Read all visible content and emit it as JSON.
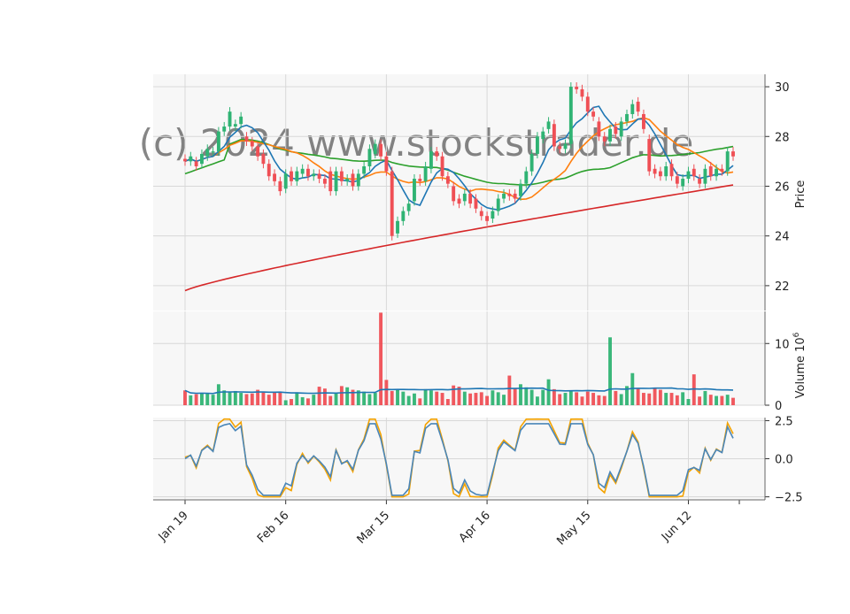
{
  "chart_data": {
    "type": "candlestick",
    "watermark": "(c) 2024 www.stockstrader.de",
    "x_tick_labels": [
      "Jan 19",
      "Feb 16",
      "Mar 15",
      "Apr 16",
      "May 15",
      "Jun 12"
    ],
    "colors": {
      "up": "#2fb373",
      "down": "#ef4f55",
      "ma_fast": "#1f77b4",
      "ma_mid": "#ff7f0e",
      "ma_slow": "#2ca02c",
      "ma_long": "#d62728",
      "vol_avg": "#1f77b4",
      "osc_a": "#4a86b8",
      "osc_b": "#f5a300",
      "grid": "#d8d8d8",
      "panel_bg": "#f7f7f7"
    },
    "panels": {
      "price": {
        "ylabel": "Price",
        "ylim": [
          21,
          30.5
        ],
        "ticks": [
          22,
          24,
          26,
          28,
          30
        ]
      },
      "volume": {
        "ylabel": "Volume",
        "ylabel_exp": "6",
        "ylim": [
          0,
          15.2
        ],
        "ticks": [
          0,
          10
        ]
      },
      "oscillator": {
        "ylim": [
          -2.7,
          2.7
        ],
        "ticks": [
          2.5,
          0.0,
          -2.5
        ],
        "tick_labels": [
          "2.5",
          "0.0",
          "−2.5"
        ]
      }
    },
    "ohlc_close": [
      27.0,
      27.2,
      26.8,
      27.3,
      27.5,
      27.4,
      28.2,
      28.4,
      29.0,
      28.5,
      28.8,
      27.8,
      27.6,
      27.2,
      26.9,
      26.4,
      26.2,
      25.8,
      26.5,
      26.2,
      26.6,
      26.7,
      26.4,
      26.5,
      26.3,
      26.1,
      25.8,
      26.6,
      26.2,
      26.3,
      26.0,
      26.5,
      26.8,
      27.5,
      27.7,
      27.2,
      26.6,
      24.0,
      24.6,
      25.0,
      25.3,
      26.3,
      26.2,
      26.8,
      27.4,
      27.2,
      26.4,
      26.1,
      25.4,
      25.3,
      25.7,
      25.3,
      25.1,
      24.8,
      24.6,
      25.0,
      25.5,
      25.7,
      25.6,
      25.5,
      26.1,
      26.6,
      27.3,
      28.0,
      28.2,
      28.6,
      27.6,
      27.5,
      27.7,
      30.0,
      29.9,
      29.6,
      29.0,
      28.8,
      28.0,
      27.8,
      28.3,
      28.1,
      28.6,
      28.9,
      29.3,
      29.0,
      28.3,
      26.6,
      26.5,
      26.4,
      26.8,
      26.4,
      26.1,
      26.3,
      26.6,
      26.4,
      26.1,
      26.7,
      26.4,
      26.7,
      26.6,
      27.4,
      27.2
    ],
    "ohlc_open": [
      27.1,
      27.0,
      27.0,
      26.9,
      27.2,
      27.4,
      27.4,
      28.2,
      28.4,
      28.4,
      28.5,
      28.0,
      27.8,
      27.6,
      27.3,
      26.9,
      26.5,
      26.2,
      25.9,
      26.6,
      26.2,
      26.5,
      26.7,
      26.4,
      26.5,
      26.3,
      26.6,
      25.8,
      26.6,
      26.2,
      26.5,
      26.0,
      26.5,
      26.8,
      27.3,
      27.7,
      27.2,
      26.6,
      24.1,
      24.6,
      25.0,
      25.4,
      26.3,
      26.2,
      26.7,
      27.4,
      27.2,
      26.4,
      26.0,
      25.5,
      25.4,
      25.7,
      25.5,
      25.0,
      24.8,
      24.7,
      25.0,
      25.5,
      25.7,
      25.7,
      25.6,
      26.1,
      26.6,
      27.3,
      27.9,
      28.3,
      28.5,
      27.6,
      27.5,
      27.7,
      30.0,
      29.9,
      29.6,
      29.0,
      28.6,
      28.0,
      27.8,
      28.4,
      28.0,
      28.6,
      28.9,
      29.4,
      28.9,
      27.9,
      26.7,
      26.6,
      26.4,
      26.9,
      26.4,
      26.0,
      26.3,
      26.7,
      26.3,
      26.1,
      26.8,
      26.4,
      26.7,
      26.6,
      27.4
    ],
    "volume_vals": [
      2.4,
      1.6,
      1.8,
      2.0,
      1.9,
      1.7,
      3.4,
      2.4,
      2.2,
      2.3,
      2.0,
      1.8,
      1.9,
      2.5,
      2.2,
      1.7,
      2.1,
      2.2,
      0.8,
      1.0,
      2.1,
      1.3,
      1.1,
      1.7,
      3.0,
      2.7,
      1.5,
      1.9,
      3.1,
      2.9,
      2.5,
      2.4,
      2.2,
      1.8,
      2.0,
      15.0,
      4.1,
      2.3,
      2.5,
      2.2,
      1.5,
      1.9,
      1.1,
      2.6,
      2.4,
      2.2,
      2.0,
      1.0,
      3.2,
      3.0,
      2.2,
      1.9,
      2.0,
      2.1,
      1.5,
      2.4,
      2.1,
      1.7,
      4.8,
      2.8,
      3.4,
      2.9,
      2.5,
      1.4,
      2.5,
      4.2,
      2.6,
      1.8,
      2.0,
      2.4,
      2.1,
      1.4,
      2.2,
      2.0,
      1.6,
      1.5,
      11.0,
      2.3,
      1.8,
      3.1,
      5.2,
      2.7,
      2.0,
      1.9,
      2.8,
      2.5,
      2.0,
      2.0,
      1.6,
      2.1,
      1.0,
      5.0,
      1.4,
      2.3,
      1.7,
      1.5,
      1.5,
      1.7,
      1.2
    ],
    "x_tick_index": [
      0,
      18,
      36,
      54,
      72,
      90
    ]
  }
}
